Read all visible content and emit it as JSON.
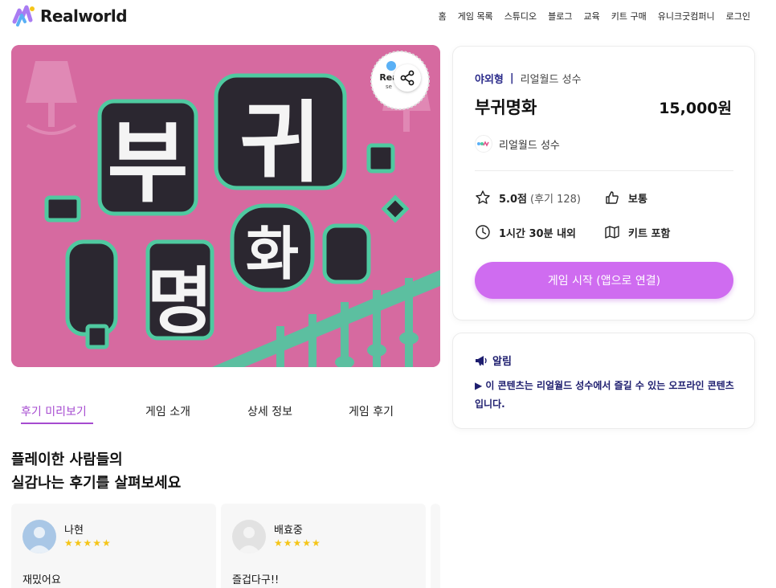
{
  "header": {
    "logo_text": "Realworld",
    "nav": [
      "홈",
      "게임 목록",
      "스튜디오",
      "블로그",
      "교육",
      "키트 구매",
      "유니크굿컴퍼니",
      "로그인"
    ]
  },
  "hero": {
    "poster_title_glyphs": [
      "부",
      "귀",
      "명",
      "화"
    ],
    "badge_text": "Rea",
    "badge_subtext": "se"
  },
  "game": {
    "type": "야외형",
    "separator": "|",
    "location": "리얼월드 성수",
    "title": "부귀명화",
    "price": "15,000원",
    "maker": "리얼월드 성수",
    "rating": "5.0점",
    "review_count": "(후기 128)",
    "difficulty": "보통",
    "duration": "1시간 30분 내외",
    "kit": "키트 포함",
    "start_button": "게임 시작 (앱으로 연결)"
  },
  "notice": {
    "heading": "알림",
    "body": "▶ 이 콘텐츠는 리얼월드 성수에서 즐길 수 있는 오프라인 콘텐츠입니다."
  },
  "tabs": [
    "후기 미리보기",
    "게임 소개",
    "상세 정보",
    "게임 후기"
  ],
  "reviews_section": {
    "title_line1": "플레이한 사람들의",
    "title_line2": "실감나는 후기를 살펴보세요"
  },
  "reviews": [
    {
      "name": "나현",
      "stars": "★★★★★",
      "text": "재밌어요"
    },
    {
      "name": "배효중",
      "stars": "★★★★★",
      "text": "즐겁다구!!"
    }
  ],
  "colors": {
    "accent": "#cf6cf0",
    "accent_text": "#a64bd0",
    "navy": "#1d1d6e",
    "poster_pink": "#d66aa0",
    "poster_green": "#4fc9a0"
  }
}
